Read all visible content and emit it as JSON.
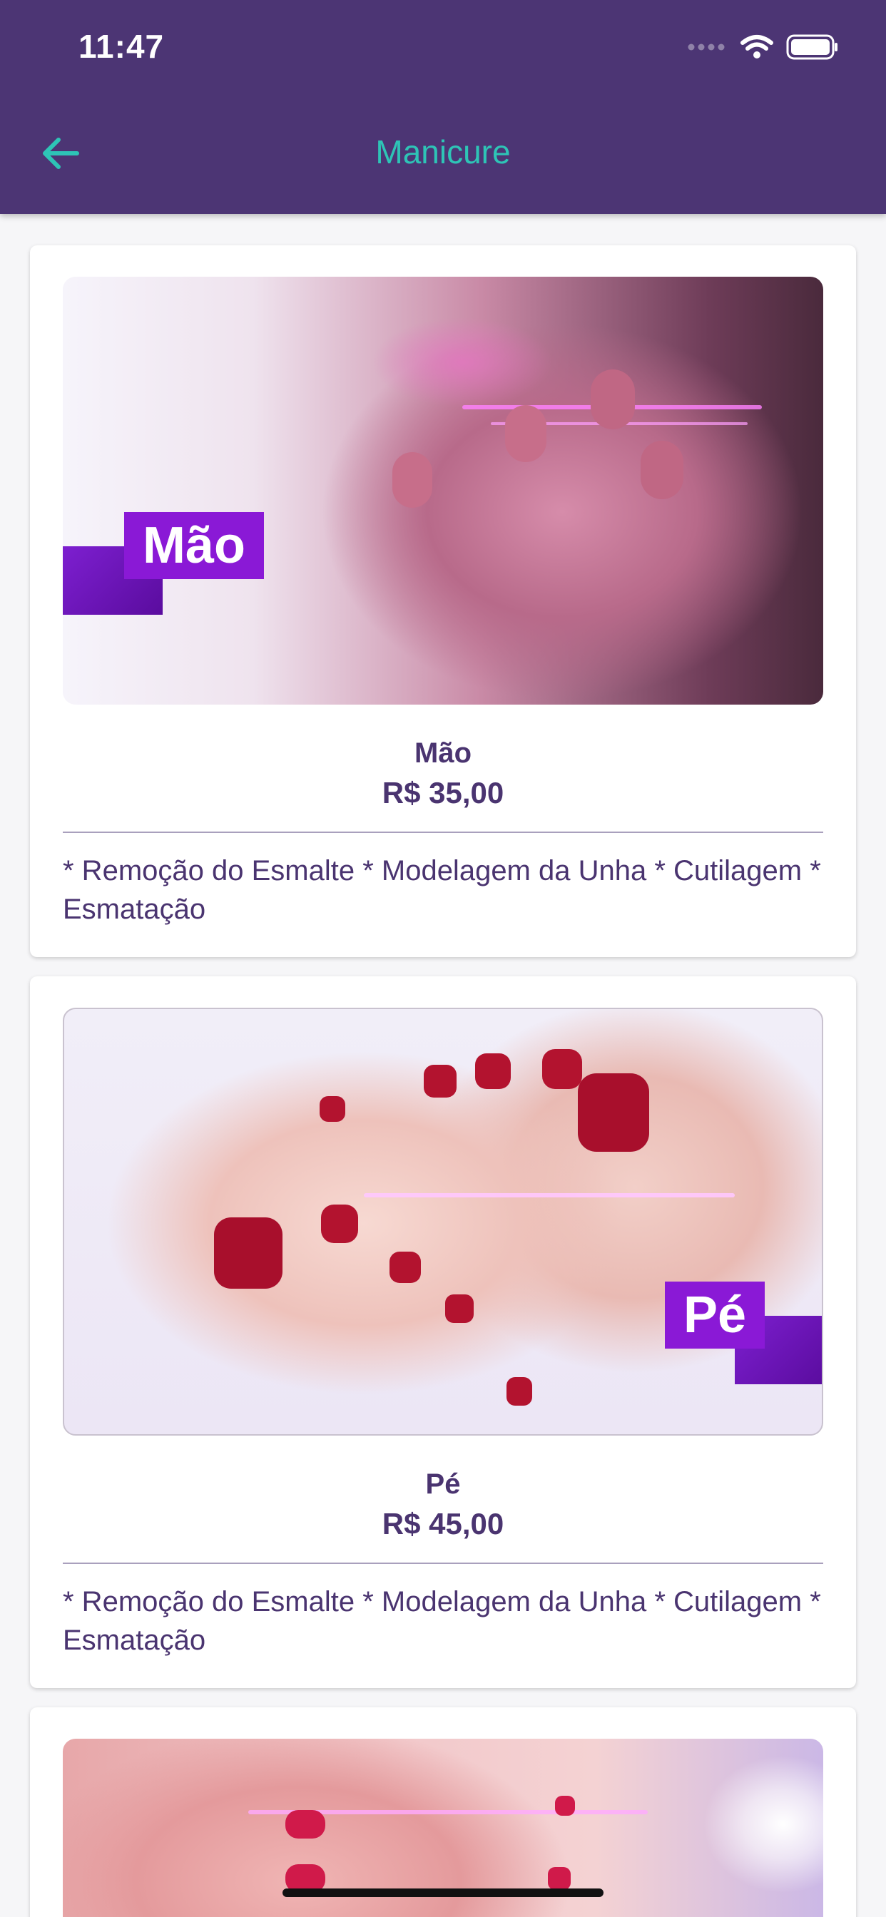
{
  "status_bar": {
    "time": "11:47"
  },
  "header": {
    "title": "Manicure"
  },
  "services": [
    {
      "name": "Mão",
      "price": "R$ 35,00",
      "description": "* Remoção do Esmalte * Modelagem da Unha * Cutilagem * Esmatação",
      "badge": "Mão"
    },
    {
      "name": "Pé",
      "price": "R$ 45,00",
      "description": "* Remoção do Esmalte * Modelagem da Unha * Cutilagem * Esmatação",
      "badge": "Pé"
    }
  ],
  "colors": {
    "header_bg": "#4c3574",
    "accent": "#2ec4b6",
    "text": "#4a3470",
    "badge": "#8a19d6"
  },
  "icons": {
    "back": "arrow-left-icon",
    "signal": "signal-icon",
    "wifi": "wifi-icon",
    "battery": "battery-icon"
  }
}
